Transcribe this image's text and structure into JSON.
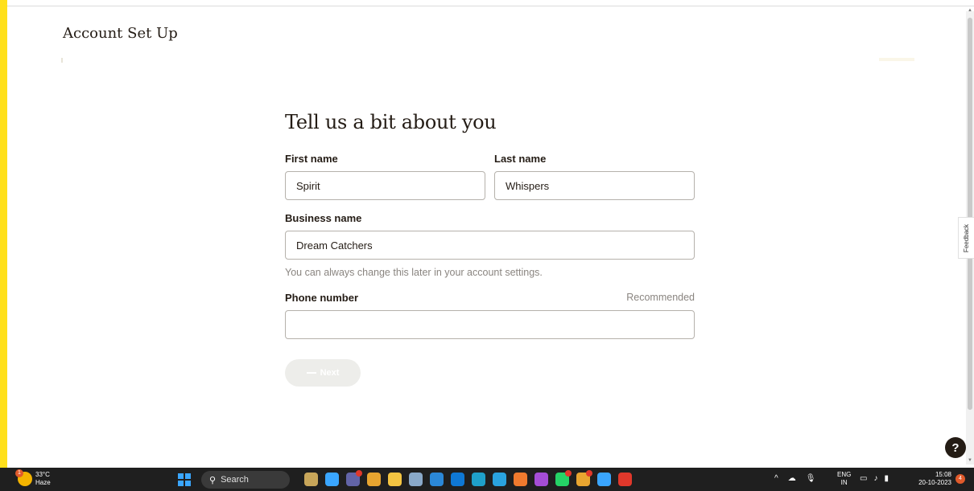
{
  "header": {
    "title": "Account Set Up"
  },
  "form": {
    "heading": "Tell us a bit about you",
    "first_name": {
      "label": "First name",
      "value": "Spirit"
    },
    "last_name": {
      "label": "Last name",
      "value": "Whispers"
    },
    "business_name": {
      "label": "Business name",
      "value": "Dream Catchers",
      "helper": "You can always change this later in your account settings."
    },
    "phone": {
      "label": "Phone number",
      "value": "",
      "hint": "Recommended"
    },
    "next_label": "Next"
  },
  "sidebar": {
    "feedback_label": "Feedback"
  },
  "help": {
    "label": "?"
  },
  "taskbar": {
    "weather_temp": "33°C",
    "weather_desc": "Haze",
    "weather_badge": "1",
    "search_label": "Search",
    "lang_top": "ENG",
    "lang_bottom": "IN",
    "time": "15:08",
    "date": "20-10-2023",
    "notification_count": "4",
    "icons": [
      {
        "name": "chat-app-icon",
        "color": "#c8a65a"
      },
      {
        "name": "widgets-icon",
        "color": "#3aa6ff"
      },
      {
        "name": "teams-icon",
        "color": "#6264a7"
      },
      {
        "name": "chrome-icon",
        "color": "#e8a530"
      },
      {
        "name": "file-explorer-icon",
        "color": "#f4c542"
      },
      {
        "name": "settings-icon",
        "color": "#8aa9c9"
      },
      {
        "name": "store-icon",
        "color": "#2b88d8"
      },
      {
        "name": "mail-icon",
        "color": "#0f78d4"
      },
      {
        "name": "edge-icon",
        "color": "#1fa0c9"
      },
      {
        "name": "telegram-icon",
        "color": "#2aa3df"
      },
      {
        "name": "firefox-icon",
        "color": "#f07a2e"
      },
      {
        "name": "app-purple-icon",
        "color": "#a54dd6"
      },
      {
        "name": "whatsapp-icon",
        "color": "#25d366"
      },
      {
        "name": "chrome-profile-icon",
        "color": "#e8a530"
      },
      {
        "name": "chrome-profile-2-icon",
        "color": "#3aa6ff"
      },
      {
        "name": "video-app-icon",
        "color": "#e0382b"
      }
    ]
  },
  "colors": {
    "accent": "#ffe01b",
    "text": "#241c15",
    "muted": "#8a8580"
  }
}
